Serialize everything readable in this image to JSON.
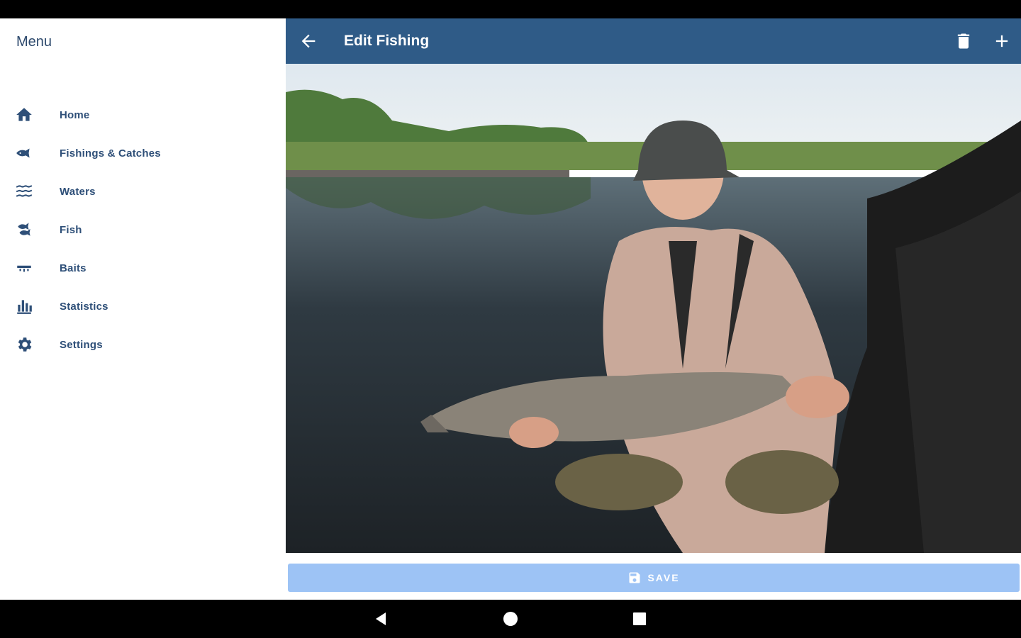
{
  "drawer": {
    "title": "Menu",
    "items": [
      {
        "label": "Home",
        "icon": "home-icon"
      },
      {
        "label": "Fishings & Catches",
        "icon": "fish-icon"
      },
      {
        "label": "Waters",
        "icon": "waves-icon"
      },
      {
        "label": "Fish",
        "icon": "fish-species-icon"
      },
      {
        "label": "Baits",
        "icon": "bait-icon"
      },
      {
        "label": "Statistics",
        "icon": "bar-chart-icon"
      },
      {
        "label": "Settings",
        "icon": "gear-icon"
      }
    ]
  },
  "app_bar": {
    "title": "Edit Fishing",
    "back_icon": "arrow-left-icon",
    "delete_icon": "trash-icon",
    "add_icon": "plus-icon",
    "color": "#2f5b87"
  },
  "photo": {
    "description_icon": "catch-photo"
  },
  "save_button": {
    "label": "SAVE",
    "icon": "floppy-disk-icon",
    "color": "#9dc3f5"
  },
  "nav": {
    "back_icon": "triangle-back-icon",
    "home_icon": "circle-home-icon",
    "recents_icon": "square-recents-icon"
  }
}
